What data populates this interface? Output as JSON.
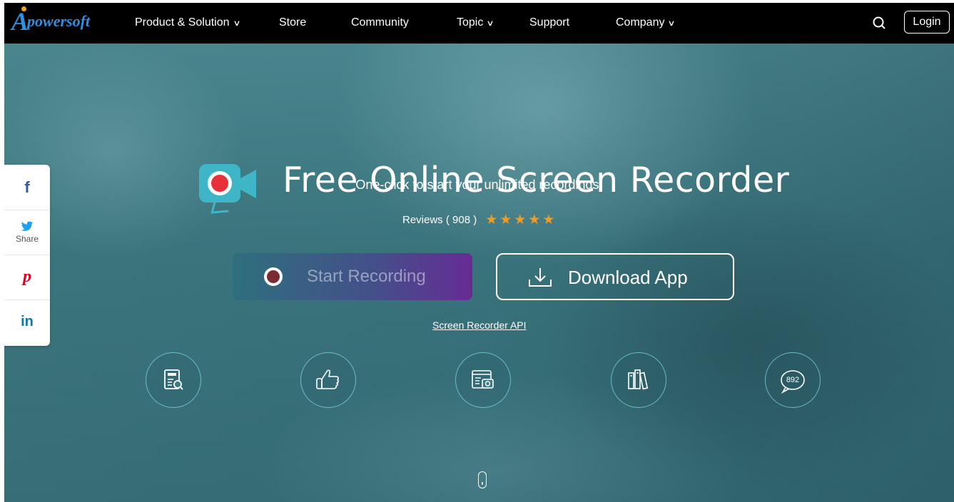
{
  "nav": {
    "logo_text": "powersoft",
    "logo_letter": "A",
    "items": [
      {
        "label": "Product & Solution",
        "has_dropdown": true
      },
      {
        "label": "Store",
        "has_dropdown": false
      },
      {
        "label": "Community",
        "has_dropdown": false
      },
      {
        "label": "Topic",
        "has_dropdown": true
      },
      {
        "label": "Support",
        "has_dropdown": false
      },
      {
        "label": "Company",
        "has_dropdown": true
      }
    ],
    "search_icon": "search-icon",
    "login_label": "Login"
  },
  "share": {
    "items": [
      {
        "icon": "facebook-icon",
        "glyph": "f",
        "label": ""
      },
      {
        "icon": "twitter-icon",
        "glyph": "",
        "label": "Share"
      },
      {
        "icon": "pinterest-icon",
        "glyph": "p",
        "label": ""
      },
      {
        "icon": "linkedin-icon",
        "glyph": "in",
        "label": ""
      }
    ]
  },
  "hero": {
    "title": "Free Online Screen Recorder",
    "subtitle": "One-click to start your unlimited recordings!",
    "reviews_label": "Reviews ( 908 )",
    "rating_stars": 5,
    "start_button": "Start Recording",
    "download_button": "Download App",
    "api_link": "Screen Recorder API",
    "features": [
      {
        "icon": "document-search-icon"
      },
      {
        "icon": "thumbs-up-icon"
      },
      {
        "icon": "screenshot-camera-icon"
      },
      {
        "icon": "library-books-icon"
      },
      {
        "icon": "comment-count-icon",
        "count": "892"
      }
    ]
  },
  "colors": {
    "nav_bg": "#000000",
    "star": "#f39a22",
    "facebook": "#3b5998",
    "twitter": "#1da1f2",
    "pinterest": "#e60023",
    "linkedin": "#0e76a8",
    "record_red": "#e8303a",
    "camera_teal": "#3fb6c7"
  }
}
